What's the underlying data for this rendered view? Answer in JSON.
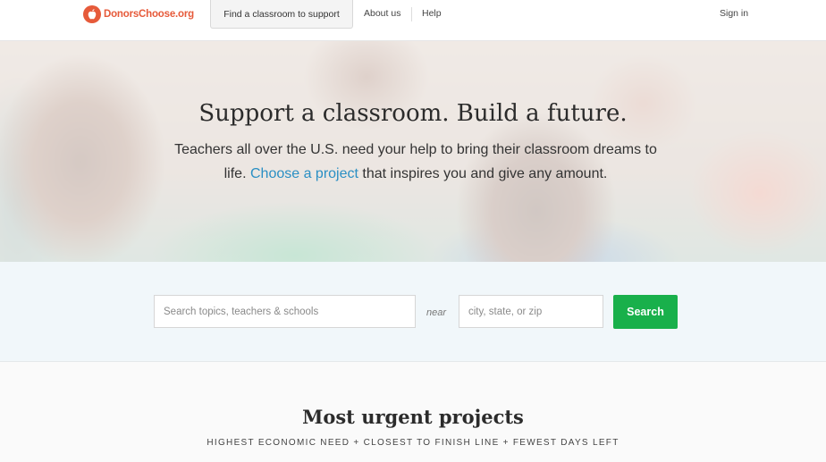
{
  "nav": {
    "logo_text": "DonorsChoose.org",
    "logo_icon": "apple-logo-icon",
    "find_classroom": "Find a classroom to support",
    "about": "About us",
    "help": "Help",
    "sign_in": "Sign in"
  },
  "hero": {
    "title": "Support a classroom. Build a future.",
    "text_before": "Teachers all over the U.S. need your help to bring their classroom dreams to life.",
    "link": "Choose a project",
    "text_after": "that inspires you and give any amount."
  },
  "search": {
    "topics_placeholder": "Search topics, teachers & schools",
    "near": "near",
    "location_placeholder": "city, state, or zip",
    "button": "Search"
  },
  "urgent": {
    "title": "Most urgent projects",
    "subtitle": "HIGHEST ECONOMIC NEED + CLOSEST TO FINISH LINE + FEWEST DAYS LEFT"
  },
  "colors": {
    "brand": "#e65a3a",
    "link": "#2a8fc4",
    "search_button": "#19b04b"
  }
}
